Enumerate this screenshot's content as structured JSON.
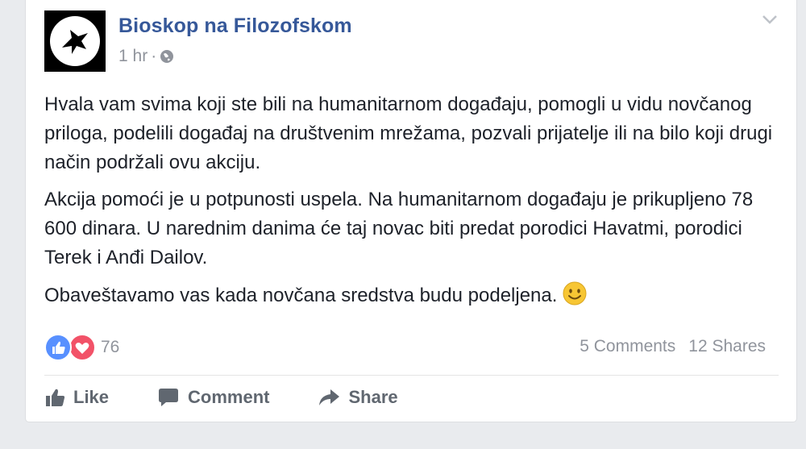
{
  "post": {
    "page_name": "Bioskop na Filozofskom",
    "time": "1 hr",
    "separator": "·",
    "paragraphs": [
      "Hvala vam svima koji ste bili na humanitarnom događaju, pomogli u vidu novčanog priloga, podelili događaj na društvenim mrežama, pozvali prijatelje ili na bilo koji drugi način podržali ovu akciju.",
      "Akcija pomoći je u potpunosti uspela. Na humanitarnom događaju je prikupljeno 78 600 dinara. U narednim danima će taj novac biti predat porodici Havatmi, porodici Terek i Anđi Dailov.",
      "Obaveštavamo vas kada novčana sredstva budu podeljena."
    ],
    "reaction_count": "76",
    "comments": "5 Comments",
    "shares": "12 Shares"
  },
  "actions": {
    "like": "Like",
    "comment": "Comment",
    "share": "Share"
  },
  "colors": {
    "link": "#365899",
    "muted": "#90949c",
    "like_blue": "#5890ff",
    "love_red": "#f25268",
    "emoji_yellow": "#f7c634"
  }
}
